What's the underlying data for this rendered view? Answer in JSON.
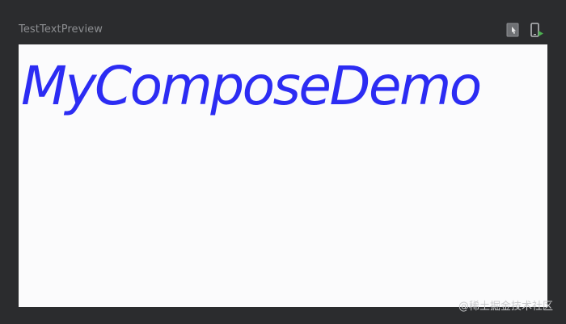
{
  "preview": {
    "title": "TestTextPreview",
    "text": "MyComposeDemo",
    "text_color": "#2c2cf3",
    "background_color": "#fbfbfc"
  },
  "toolbar": {
    "icons": [
      "interactive-mode-icon",
      "deploy-to-device-icon"
    ]
  },
  "watermark": "@稀土掘金技术社区"
}
